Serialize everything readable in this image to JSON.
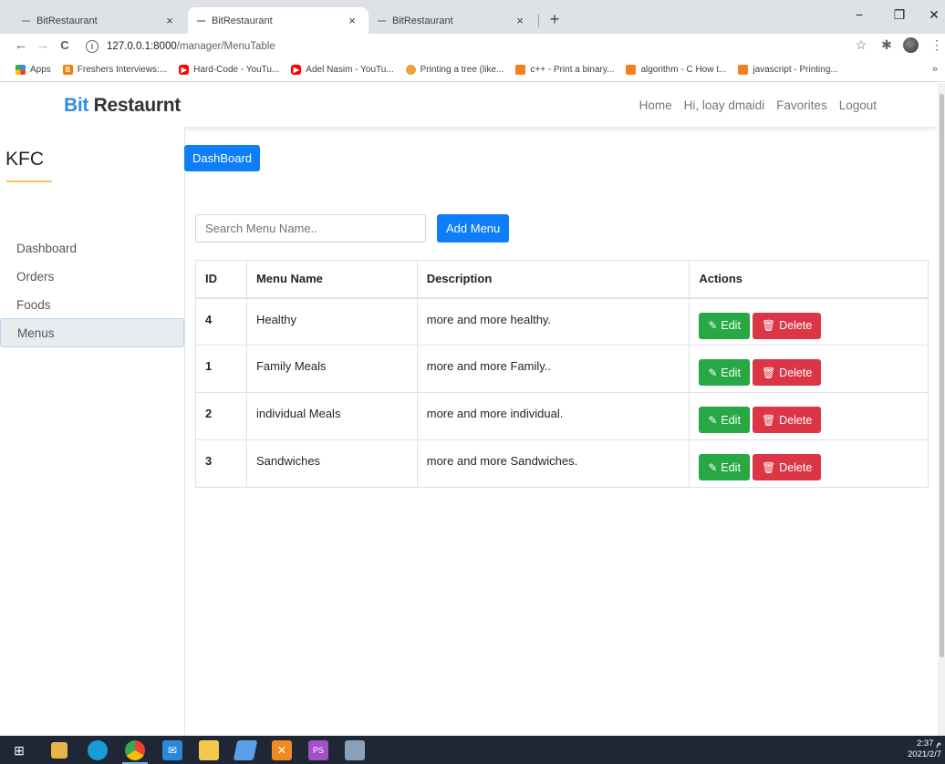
{
  "browser": {
    "tabs": [
      {
        "title": "BitRestaurant",
        "close": "×",
        "active": false
      },
      {
        "title": "BitRestaurant",
        "close": "×",
        "active": true
      },
      {
        "title": "BitRestaurant",
        "close": "×",
        "active": false
      }
    ],
    "new_tab": "+",
    "window_controls": {
      "minimize": "−",
      "maximize": "❐",
      "close": "✕"
    },
    "nav": {
      "back": "←",
      "forward": "→",
      "reload": "C"
    },
    "url_host": "127.0.0.1:8000",
    "url_path": "/manager/MenuTable",
    "info_glyph": "i",
    "star": "☆",
    "extensions": "✱",
    "menu": "⋮",
    "bookmarks": [
      {
        "label": "Apps",
        "icon": "apps-grid-icon",
        "color": "#4285f4"
      },
      {
        "label": "Freshers Interviews:...",
        "icon": "blogger-icon",
        "color": "#f57d00"
      },
      {
        "label": "Hard-Code - YouTu...",
        "icon": "youtube-icon",
        "color": "#ff0000"
      },
      {
        "label": "Adel Nasim - YouTu...",
        "icon": "youtube-icon",
        "color": "#ff0000"
      },
      {
        "label": "Printing a tree (like...",
        "icon": "stackoverflow-icon",
        "color": "#f48024"
      },
      {
        "label": "c++ - Print a binary...",
        "icon": "stackoverflow-icon",
        "color": "#f48024"
      },
      {
        "label": "algorithm - C How t...",
        "icon": "stackoverflow-icon",
        "color": "#f48024"
      },
      {
        "label": "javascript - Printing...",
        "icon": "stackoverflow-icon",
        "color": "#f48024"
      }
    ],
    "bookmarks_more": "»"
  },
  "navbar": {
    "brand_prefix": "Bit",
    "brand_suffix": " Restaurnt",
    "links": {
      "home": "Home",
      "greeting": "Hi, loay dmaidi",
      "favorites": "Favorites",
      "logout": "Logout"
    }
  },
  "sidebar": {
    "title": "KFC",
    "items": [
      {
        "label": "Dashboard",
        "active": false
      },
      {
        "label": "Orders",
        "active": false
      },
      {
        "label": "Foods",
        "active": false
      },
      {
        "label": "Menus",
        "active": true
      }
    ]
  },
  "main": {
    "dashboard_button": "DashBoard",
    "search_placeholder": "Search Menu Name..",
    "search_value": "",
    "add_button": "Add Menu",
    "table": {
      "headers": [
        "ID",
        "Menu Name",
        "Description",
        "Actions"
      ],
      "rows": [
        {
          "id": "4",
          "name": "Healthy",
          "description": "more and more healthy."
        },
        {
          "id": "1",
          "name": "Family Meals",
          "description": "more and more Family.."
        },
        {
          "id": "2",
          "name": "individual Meals",
          "description": "more and more individual."
        },
        {
          "id": "3",
          "name": "Sandwiches",
          "description": "more and more Sandwiches."
        }
      ],
      "edit_label": "Edit",
      "delete_label": "Delete"
    }
  },
  "colors": {
    "primary": "#0d7ef7",
    "success": "#28a745",
    "danger": "#dc3545",
    "brand_accent": "#2f8fdc",
    "taskbar": "#1f2735"
  },
  "taskbar": {
    "time": "2:37 م",
    "date": "2021/2/7"
  }
}
